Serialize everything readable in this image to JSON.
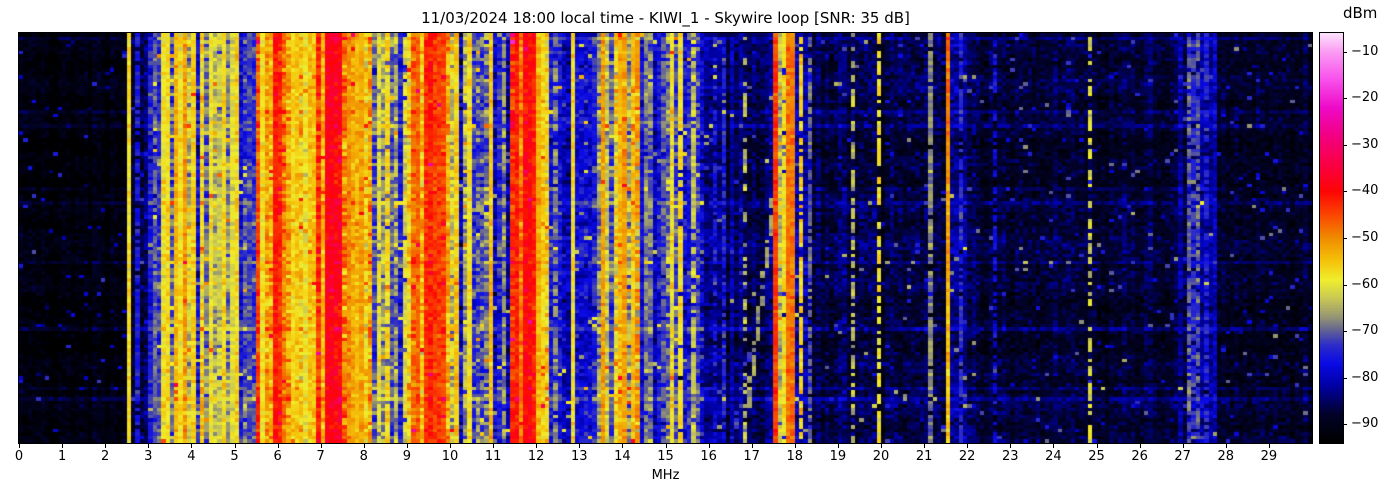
{
  "chart_data": {
    "type": "heatmap",
    "title": "11/03/2024 18:00 local time - KIWI_1 - Skywire loop [SNR: 35 dB]",
    "xlabel": "MHz",
    "x_range": [
      0,
      30
    ],
    "x_ticks": [
      0,
      1,
      2,
      3,
      4,
      5,
      6,
      7,
      8,
      9,
      10,
      11,
      12,
      13,
      14,
      15,
      16,
      17,
      18,
      19,
      20,
      21,
      22,
      23,
      24,
      25,
      26,
      27,
      28,
      29
    ],
    "y_axis": "time (no tick labels shown)",
    "grid": false,
    "colorbar": {
      "label": "dBm",
      "vmin": -94,
      "vmax": -6,
      "ticks": [
        -10,
        -20,
        -30,
        -40,
        -50,
        -60,
        -70,
        -80,
        -90
      ],
      "tick_labels": [
        "−10",
        "−20",
        "−30",
        "−40",
        "−50",
        "−60",
        "−70",
        "−80",
        "−90"
      ],
      "colormap": [
        [
          -94,
          "#000000"
        ],
        [
          -88,
          "#020228"
        ],
        [
          -82,
          "#0000a0"
        ],
        [
          -77,
          "#0a0ae6"
        ],
        [
          -73,
          "#2d2dc8"
        ],
        [
          -70,
          "#5f5f96"
        ],
        [
          -67,
          "#969673"
        ],
        [
          -63,
          "#c8c855"
        ],
        [
          -59,
          "#f0ee2d"
        ],
        [
          -55,
          "#f5c30a"
        ],
        [
          -50,
          "#f08c00"
        ],
        [
          -45,
          "#fa4600"
        ],
        [
          -40,
          "#fd0505"
        ],
        [
          -35,
          "#fa003c"
        ],
        [
          -28,
          "#f20082"
        ],
        [
          -22,
          "#ee0ac8"
        ],
        [
          -16,
          "#f850eb"
        ],
        [
          -10,
          "#fa9bf3"
        ],
        [
          -6,
          "#fde1fc"
        ]
      ]
    },
    "spectrum": {
      "bins": 300,
      "rows": 117,
      "seed": 42,
      "segments": [
        [
          0.0,
          2.5,
          -92,
          1.5,
          3
        ],
        [
          2.5,
          3.05,
          -88,
          2,
          4
        ],
        [
          3.05,
          3.3,
          -80,
          5,
          5
        ],
        [
          3.3,
          4.65,
          -68,
          8,
          7
        ],
        [
          4.65,
          5.12,
          -72,
          7,
          6
        ],
        [
          5.12,
          5.55,
          -78,
          5,
          5
        ],
        [
          5.55,
          5.87,
          -62,
          7,
          6
        ],
        [
          5.87,
          6.25,
          -48,
          5,
          6
        ],
        [
          6.25,
          6.95,
          -62,
          8,
          7
        ],
        [
          6.95,
          7.5,
          -45,
          5,
          5
        ],
        [
          7.5,
          8.2,
          -60,
          8,
          7
        ],
        [
          8.2,
          9.05,
          -72,
          7,
          6
        ],
        [
          9.05,
          9.45,
          -58,
          7,
          6
        ],
        [
          9.45,
          10.05,
          -49,
          6,
          6
        ],
        [
          10.05,
          10.45,
          -66,
          8,
          7
        ],
        [
          10.45,
          11.45,
          -76,
          5,
          6
        ],
        [
          11.45,
          12.05,
          -46,
          5,
          5
        ],
        [
          12.05,
          12.3,
          -60,
          7,
          6
        ],
        [
          12.3,
          13.35,
          -77,
          5,
          5
        ],
        [
          13.35,
          13.85,
          -72,
          6,
          6
        ],
        [
          13.85,
          14.42,
          -62,
          7,
          7
        ],
        [
          14.42,
          15.05,
          -79,
          5,
          5
        ],
        [
          15.05,
          15.9,
          -74,
          6,
          6
        ],
        [
          15.9,
          16.85,
          -85,
          2.5,
          4
        ],
        [
          16.85,
          17.5,
          -86,
          2,
          4
        ],
        [
          17.5,
          18.0,
          -72,
          7,
          6
        ],
        [
          18.0,
          18.35,
          -79,
          5,
          5
        ],
        [
          18.35,
          19.25,
          -87,
          2,
          4
        ],
        [
          19.25,
          21.4,
          -87,
          2,
          4
        ],
        [
          21.4,
          22.25,
          -85,
          3,
          4
        ],
        [
          22.25,
          26.9,
          -88,
          1.5,
          3.5
        ],
        [
          26.9,
          27.85,
          -84,
          3,
          4
        ],
        [
          27.85,
          30.1,
          -89,
          1.5,
          3.5
        ]
      ],
      "carriers": [
        [
          2.56,
          0.05,
          -58,
          1
        ],
        [
          2.75,
          0.05,
          -75,
          0.9
        ],
        [
          3.1,
          0.05,
          -70,
          0.9
        ],
        [
          3.33,
          0.05,
          -59,
          1
        ],
        [
          3.48,
          0.05,
          -57,
          1
        ],
        [
          3.62,
          0.05,
          -54,
          1
        ],
        [
          3.75,
          0.05,
          -58,
          1
        ],
        [
          3.88,
          0.05,
          -52,
          1
        ],
        [
          4.05,
          0.05,
          -56,
          1
        ],
        [
          4.25,
          0.05,
          -61,
          1
        ],
        [
          4.47,
          0.05,
          -59,
          1
        ],
        [
          4.62,
          0.05,
          -63,
          0.9
        ],
        [
          4.77,
          0.05,
          -57,
          1
        ],
        [
          4.95,
          0.05,
          -61,
          1
        ],
        [
          5.06,
          0.05,
          -57,
          1
        ],
        [
          5.35,
          0.05,
          -72,
          0.9
        ],
        [
          5.62,
          0.05,
          -58,
          1
        ],
        [
          5.75,
          0.05,
          -62,
          1
        ],
        [
          5.95,
          0.08,
          -42,
          1
        ],
        [
          6.08,
          0.06,
          -44,
          1
        ],
        [
          6.3,
          0.05,
          -57,
          1
        ],
        [
          6.45,
          0.05,
          -55,
          1
        ],
        [
          6.62,
          0.05,
          -60,
          1
        ],
        [
          6.8,
          0.05,
          -55,
          1
        ],
        [
          7.2,
          0.1,
          -38,
          1
        ],
        [
          7.35,
          0.06,
          -42,
          1
        ],
        [
          7.62,
          0.05,
          -50,
          1
        ],
        [
          7.8,
          0.05,
          -54,
          1
        ],
        [
          8.0,
          0.05,
          -52,
          1
        ],
        [
          8.35,
          0.05,
          -59,
          0.9
        ],
        [
          8.6,
          0.05,
          -57,
          0.9
        ],
        [
          8.9,
          0.05,
          -61,
          0.9
        ],
        [
          9.15,
          0.05,
          -52,
          1
        ],
        [
          9.25,
          0.05,
          -47,
          1
        ],
        [
          9.5,
          0.06,
          -43,
          1
        ],
        [
          9.65,
          0.06,
          -44,
          1
        ],
        [
          9.8,
          0.06,
          -45,
          1
        ],
        [
          10.0,
          0.05,
          -55,
          1
        ],
        [
          10.15,
          0.05,
          -56,
          1
        ],
        [
          10.4,
          0.05,
          -58,
          1
        ],
        [
          10.9,
          0.04,
          -55,
          1
        ],
        [
          11.0,
          0.05,
          -62,
          0.9
        ],
        [
          11.25,
          0.05,
          -66,
          0.8
        ],
        [
          11.55,
          0.05,
          -42,
          1
        ],
        [
          11.8,
          0.08,
          -40,
          1
        ],
        [
          11.94,
          0.06,
          -42,
          1
        ],
        [
          12.05,
          0.05,
          -54,
          1
        ],
        [
          12.16,
          0.05,
          -57,
          1
        ],
        [
          12.45,
          0.04,
          -68,
          0.8
        ],
        [
          12.86,
          0.04,
          -58,
          1
        ],
        [
          13.56,
          0.05,
          -52,
          1
        ],
        [
          13.95,
          0.05,
          -55,
          1
        ],
        [
          14.08,
          0.05,
          -52,
          1
        ],
        [
          14.22,
          0.05,
          -56,
          1
        ],
        [
          14.35,
          0.05,
          -50,
          0.8
        ],
        [
          14.55,
          0.04,
          -68,
          0.9
        ],
        [
          14.9,
          0.04,
          -70,
          0.8
        ],
        [
          15.15,
          0.05,
          -60,
          0.9
        ],
        [
          15.32,
          0.05,
          -58,
          0.9
        ],
        [
          15.5,
          0.05,
          -55,
          0.9
        ],
        [
          15.64,
          0.05,
          -63,
          0.8
        ],
        [
          16.1,
          0.04,
          -76,
          0.6
        ],
        [
          16.35,
          0.04,
          -74,
          0.7
        ],
        [
          16.83,
          0.04,
          -64,
          0.35
        ],
        [
          17.56,
          0.07,
          -44,
          1
        ],
        [
          17.72,
          0.04,
          -58,
          0.9
        ],
        [
          17.9,
          0.06,
          -48,
          1
        ],
        [
          18.12,
          0.05,
          -56,
          0.8
        ],
        [
          18.4,
          0.04,
          -70,
          0.8
        ],
        [
          18.8,
          0.04,
          -78,
          0.5
        ],
        [
          19.35,
          0.04,
          -64,
          0.55
        ],
        [
          19.95,
          0.05,
          -58,
          0.7
        ],
        [
          20.3,
          0.04,
          -70,
          0.8
        ],
        [
          21.0,
          0.05,
          -57,
          0.85
        ],
        [
          21.1,
          0.04,
          -68,
          0.9
        ],
        [
          21.52,
          0.07,
          -47,
          1,
          -10
        ],
        [
          21.9,
          0.04,
          -74,
          0.8
        ],
        [
          22.6,
          0.04,
          -78,
          0.6
        ],
        [
          23.7,
          0.04,
          -62,
          0.5
        ],
        [
          24.85,
          0.04,
          -62,
          0.5
        ],
        [
          25.3,
          0.04,
          -72,
          0.7
        ],
        [
          27.0,
          0.05,
          -72,
          0.9
        ],
        [
          27.12,
          0.05,
          -70,
          0.8
        ],
        [
          27.25,
          0.05,
          -73,
          0.8
        ],
        [
          27.38,
          0.05,
          -71,
          0.8
        ],
        [
          27.55,
          0.04,
          -74,
          0.7
        ],
        [
          28.2,
          0.04,
          -63,
          0.6
        ],
        [
          29.3,
          0.04,
          -76,
          0.6
        ]
      ],
      "chirps": [
        [
          16.82,
          17.62,
          0.3,
          1.0,
          -66,
          0.8
        ],
        [
          16.55,
          16.95,
          0.78,
          1.0,
          -73,
          0.6
        ]
      ]
    }
  }
}
